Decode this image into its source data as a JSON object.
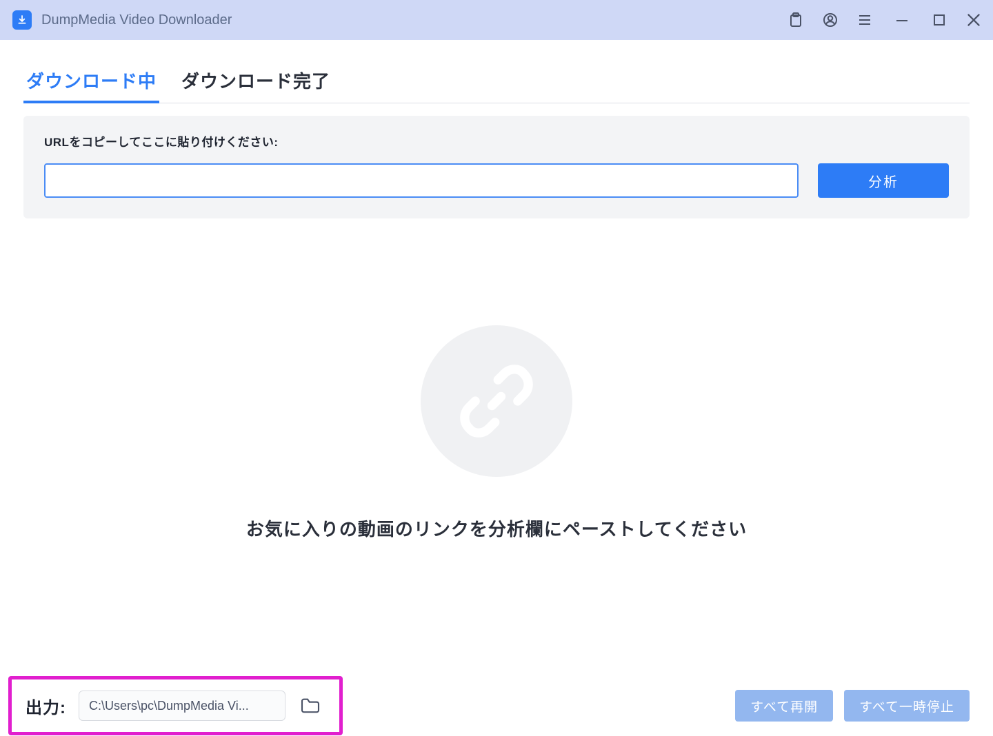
{
  "app": {
    "title": "DumpMedia Video Downloader"
  },
  "tabs": {
    "downloading": "ダウンロード中",
    "completed": "ダウンロード完了"
  },
  "url_panel": {
    "label": "URLをコピーしてここに貼り付けください:",
    "value": "",
    "analyze_label": "分析"
  },
  "empty": {
    "message": "お気に入りの動画のリンクを分析欄にペーストしてください"
  },
  "footer": {
    "output_label": "出力:",
    "output_path": "C:\\Users\\pc\\DumpMedia Vi...",
    "resume_all": "すべて再開",
    "pause_all": "すべて一時停止"
  }
}
